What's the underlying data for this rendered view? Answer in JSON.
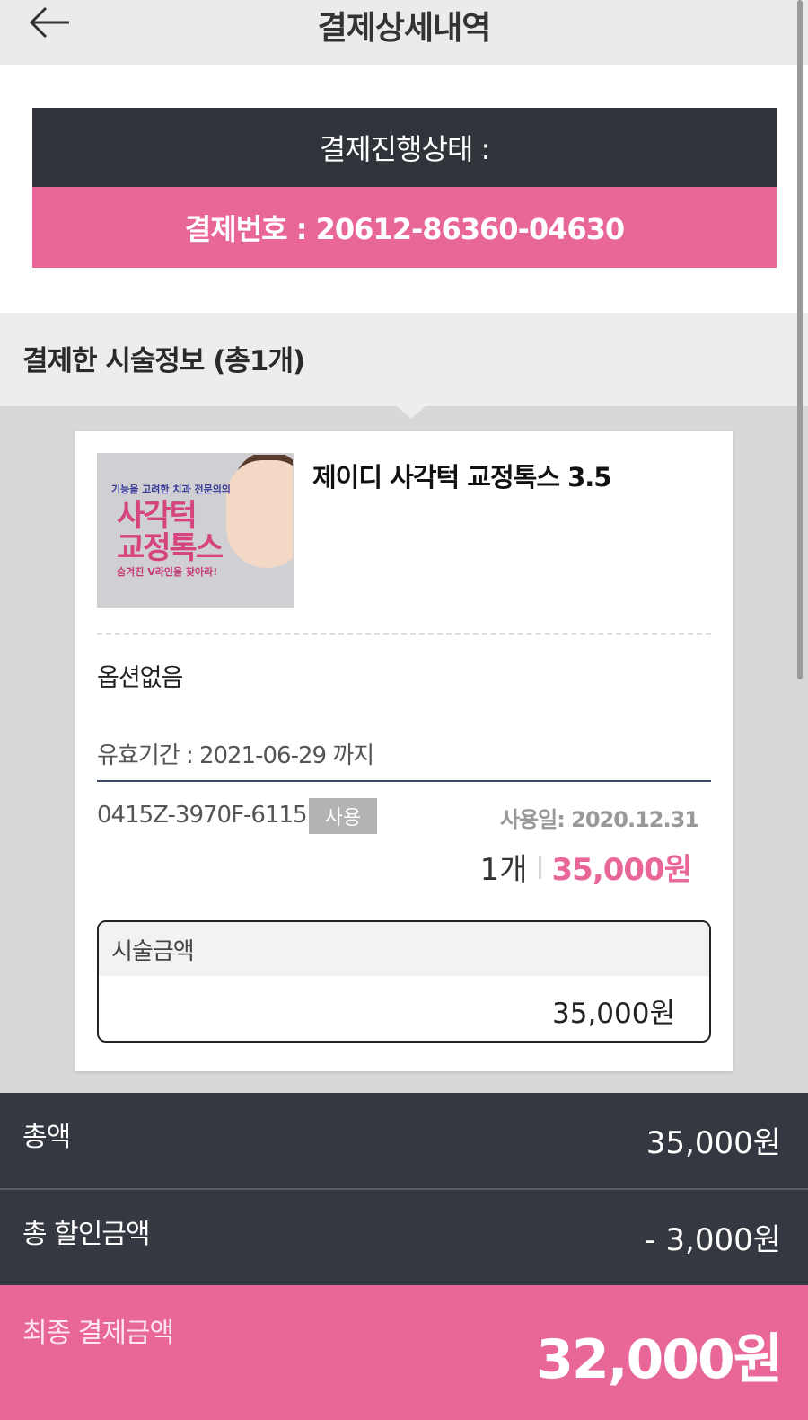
{
  "header": {
    "title": "결제상세내역",
    "back_icon": "arrow-left-icon"
  },
  "status": {
    "progress_label": "결제진행상태 :",
    "payment_number_label": "결제번호 : 20612-86360-04630"
  },
  "section": {
    "title": "결제한 시술정보 (총1개)"
  },
  "product": {
    "thumbnail": {
      "line1": "기능을 고려한 치과 전문의의",
      "line2a": "사각턱",
      "line2b": "교정톡스",
      "line3": "숨겨진 V라인을 찾아라!"
    },
    "name": "제이디 사각턱 교정톡스 3.5",
    "option": "옵션없음",
    "validity": "유효기간 : 2021-06-29 까지",
    "coupon_code": "0415Z-3970F-6115I",
    "use_badge": "사용",
    "use_date": "사용일: 2020.12.31",
    "quantity": "1개",
    "price": "35,000원",
    "amount_label": "시술금액",
    "amount_value": "35,000원"
  },
  "totals": {
    "total_label": "총액",
    "total_value": "35,000원",
    "discount_label": "총 할인금액",
    "discount_value": "- 3,000원",
    "final_label": "최종 결제금액",
    "final_value": "32,000원"
  },
  "colors": {
    "pink": "#e96699",
    "dark": "#30333a",
    "totals_dark": "#353840"
  }
}
